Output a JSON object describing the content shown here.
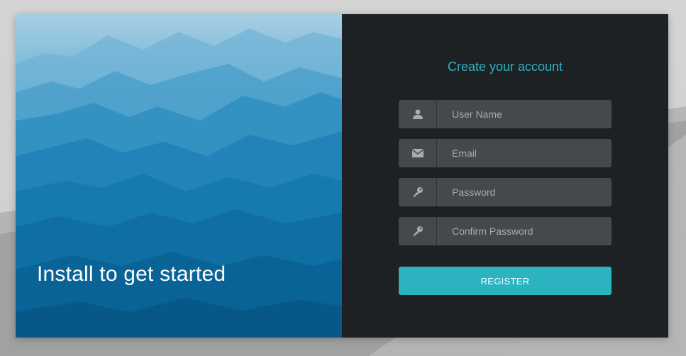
{
  "hero": {
    "tagline": "Install to get started"
  },
  "form": {
    "title": "Create your account",
    "fields": [
      {
        "icon": "user-icon",
        "placeholder": "User Name",
        "value": ""
      },
      {
        "icon": "envelope-icon",
        "placeholder": "Email",
        "value": ""
      },
      {
        "icon": "key-icon",
        "placeholder": "Password",
        "value": ""
      },
      {
        "icon": "key-icon",
        "placeholder": "Confirm Password",
        "value": ""
      }
    ],
    "submit_label": "REGISTER"
  },
  "colors": {
    "accent": "#2bb3c0",
    "panel_bg": "#1d2123",
    "field_bg": "#44494c"
  }
}
